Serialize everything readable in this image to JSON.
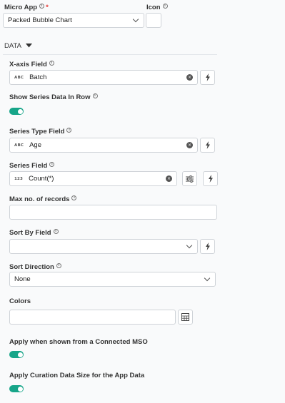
{
  "micro_app": {
    "label": "Micro App",
    "value": "Packed Bubble Chart"
  },
  "icon": {
    "label": "Icon"
  },
  "section": {
    "title": "DATA"
  },
  "x_axis_field": {
    "label": "X-axis Field",
    "type": "ABC",
    "value": "Batch"
  },
  "show_series_row": {
    "label": "Show Series Data In Row",
    "on": true
  },
  "series_type_field": {
    "label": "Series Type Field",
    "type": "ABC",
    "value": "Age"
  },
  "series_field": {
    "label": "Series Field",
    "type": "123",
    "value": "Count(*)"
  },
  "max_records": {
    "label": "Max no. of records",
    "value": ""
  },
  "sort_by_field": {
    "label": "Sort By Field",
    "value": ""
  },
  "sort_direction": {
    "label": "Sort Direction",
    "value": "None"
  },
  "colors": {
    "label": "Colors",
    "value": ""
  },
  "apply_connected_mso": {
    "label": "Apply when shown from a Connected MSO",
    "on": true
  },
  "apply_curation": {
    "label": "Apply Curation Data Size for the App Data",
    "on": true
  },
  "theme": {
    "accent": "#17a589",
    "border": "#cfd3d8",
    "background": "#f9fafb"
  }
}
